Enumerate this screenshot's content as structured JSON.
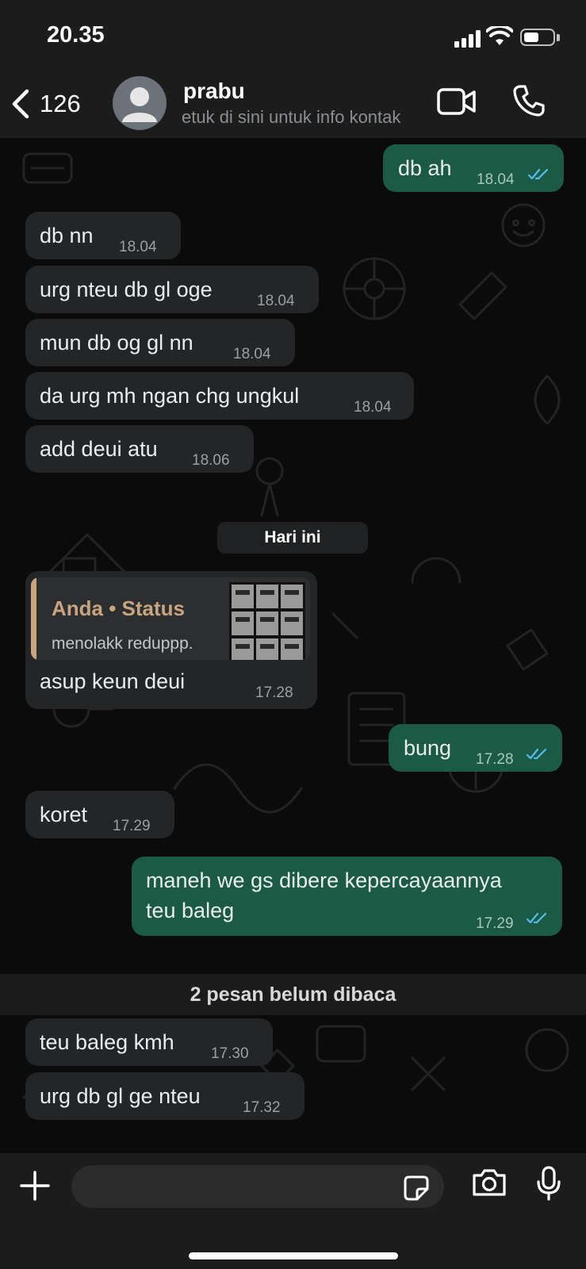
{
  "status_bar": {
    "time": "20.35",
    "battery_level": 0.55
  },
  "header": {
    "back_count": "126",
    "contact_name": "prabu",
    "contact_subtitle": "etuk di sini untuk info kontak",
    "icons": {
      "back": "chevron-left-icon",
      "avatar": "person-icon",
      "video": "video-camera-icon",
      "call": "phone-icon"
    }
  },
  "messages": [
    {
      "direction": "out",
      "text": "db ah",
      "time": "18.04",
      "status": "read"
    },
    {
      "direction": "in",
      "text": "db nn",
      "time": "18.04"
    },
    {
      "direction": "in",
      "text": "urg nteu db gl oge",
      "time": "18.04"
    },
    {
      "direction": "in",
      "text": "mun db og gl nn",
      "time": "18.04"
    },
    {
      "direction": "in",
      "text": "da urg mh ngan chg ungkul",
      "time": "18.04"
    },
    {
      "direction": "in",
      "text": "add deui atu",
      "time": "18.06"
    },
    {
      "direction": "in",
      "text": "asup keun deui",
      "time": "17.28",
      "quoted": {
        "author": "Anda • Status",
        "text": "menolakk reduppp."
      }
    },
    {
      "direction": "out",
      "text": "bung",
      "time": "17.28",
      "status": "read"
    },
    {
      "direction": "in",
      "text": "koret",
      "time": "17.29"
    },
    {
      "direction": "out",
      "text": [
        "maneh we gs dibere kepercayaannya",
        "teu baleg"
      ],
      "time": "17.29",
      "status": "read"
    },
    {
      "direction": "in",
      "text": "teu baleg kmh",
      "time": "17.30"
    },
    {
      "direction": "in",
      "text": "urg db gl ge nteu",
      "time": "17.32"
    }
  ],
  "date_divider": "Hari ini",
  "unread_divider": "2 pesan belum dibaca",
  "composer": {
    "value": "",
    "icons": {
      "attach": "plus-icon",
      "sticker": "sticker-icon",
      "camera": "camera-icon",
      "mic": "microphone-icon"
    }
  },
  "colors": {
    "incoming_bubble": "#232526",
    "outgoing_bubble": "#1b5a45",
    "read_tick": "#53bdeb",
    "quote_accent": "#c8a57e"
  }
}
